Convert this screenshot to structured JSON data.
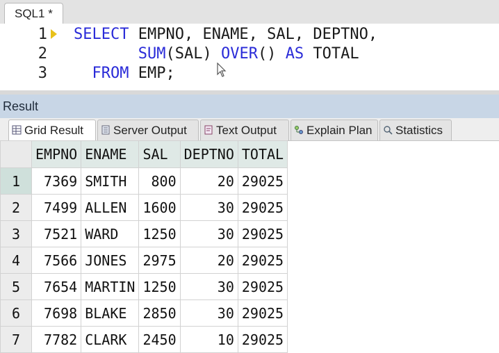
{
  "editor_tab": {
    "label": "SQL1 *"
  },
  "editor": {
    "lines": [
      {
        "num": "1",
        "parts": [
          {
            "text": "SELECT",
            "kw": true
          },
          {
            "text": " EMPNO, ENAME, SAL, DEPTNO,",
            "kw": false
          }
        ]
      },
      {
        "num": "2",
        "parts": [
          {
            "text": "       ",
            "kw": false
          },
          {
            "text": "SUM",
            "kw": true
          },
          {
            "text": "(SAL) ",
            "kw": false
          },
          {
            "text": "OVER",
            "kw": true
          },
          {
            "text": "() ",
            "kw": false
          },
          {
            "text": "AS",
            "kw": true
          },
          {
            "text": " TOTAL",
            "kw": false
          }
        ]
      },
      {
        "num": "3",
        "parts": [
          {
            "text": "  ",
            "kw": false
          },
          {
            "text": "FROM",
            "kw": true
          },
          {
            "text": " EMP;",
            "kw": false
          }
        ]
      }
    ]
  },
  "result": {
    "title": "Result",
    "tabs": [
      {
        "label": "Grid Result",
        "icon": "grid-icon",
        "active": true
      },
      {
        "label": "Server Output",
        "icon": "server-output-icon",
        "active": false
      },
      {
        "label": "Text Output",
        "icon": "text-output-icon",
        "active": false
      },
      {
        "label": "Explain Plan",
        "icon": "explain-plan-icon",
        "active": false
      },
      {
        "label": "Statistics",
        "icon": "statistics-icon",
        "active": false
      }
    ]
  },
  "grid": {
    "columns": [
      "EMPNO",
      "ENAME",
      "SAL",
      "DEPTNO",
      "TOTAL"
    ],
    "rows": [
      [
        "1",
        "7369",
        "SMITH",
        "800",
        "20",
        "29025"
      ],
      [
        "2",
        "7499",
        "ALLEN",
        "1600",
        "30",
        "29025"
      ],
      [
        "3",
        "7521",
        "WARD",
        "1250",
        "30",
        "29025"
      ],
      [
        "4",
        "7566",
        "JONES",
        "2975",
        "20",
        "29025"
      ],
      [
        "5",
        "7654",
        "MARTIN",
        "1250",
        "30",
        "29025"
      ],
      [
        "6",
        "7698",
        "BLAKE",
        "2850",
        "30",
        "29025"
      ],
      [
        "7",
        "7782",
        "CLARK",
        "2450",
        "10",
        "29025"
      ]
    ]
  },
  "colors": {
    "keyword": "#2a2bd8",
    "result_header": "#c8d6e6",
    "grid_header": "#dfe9e6"
  }
}
